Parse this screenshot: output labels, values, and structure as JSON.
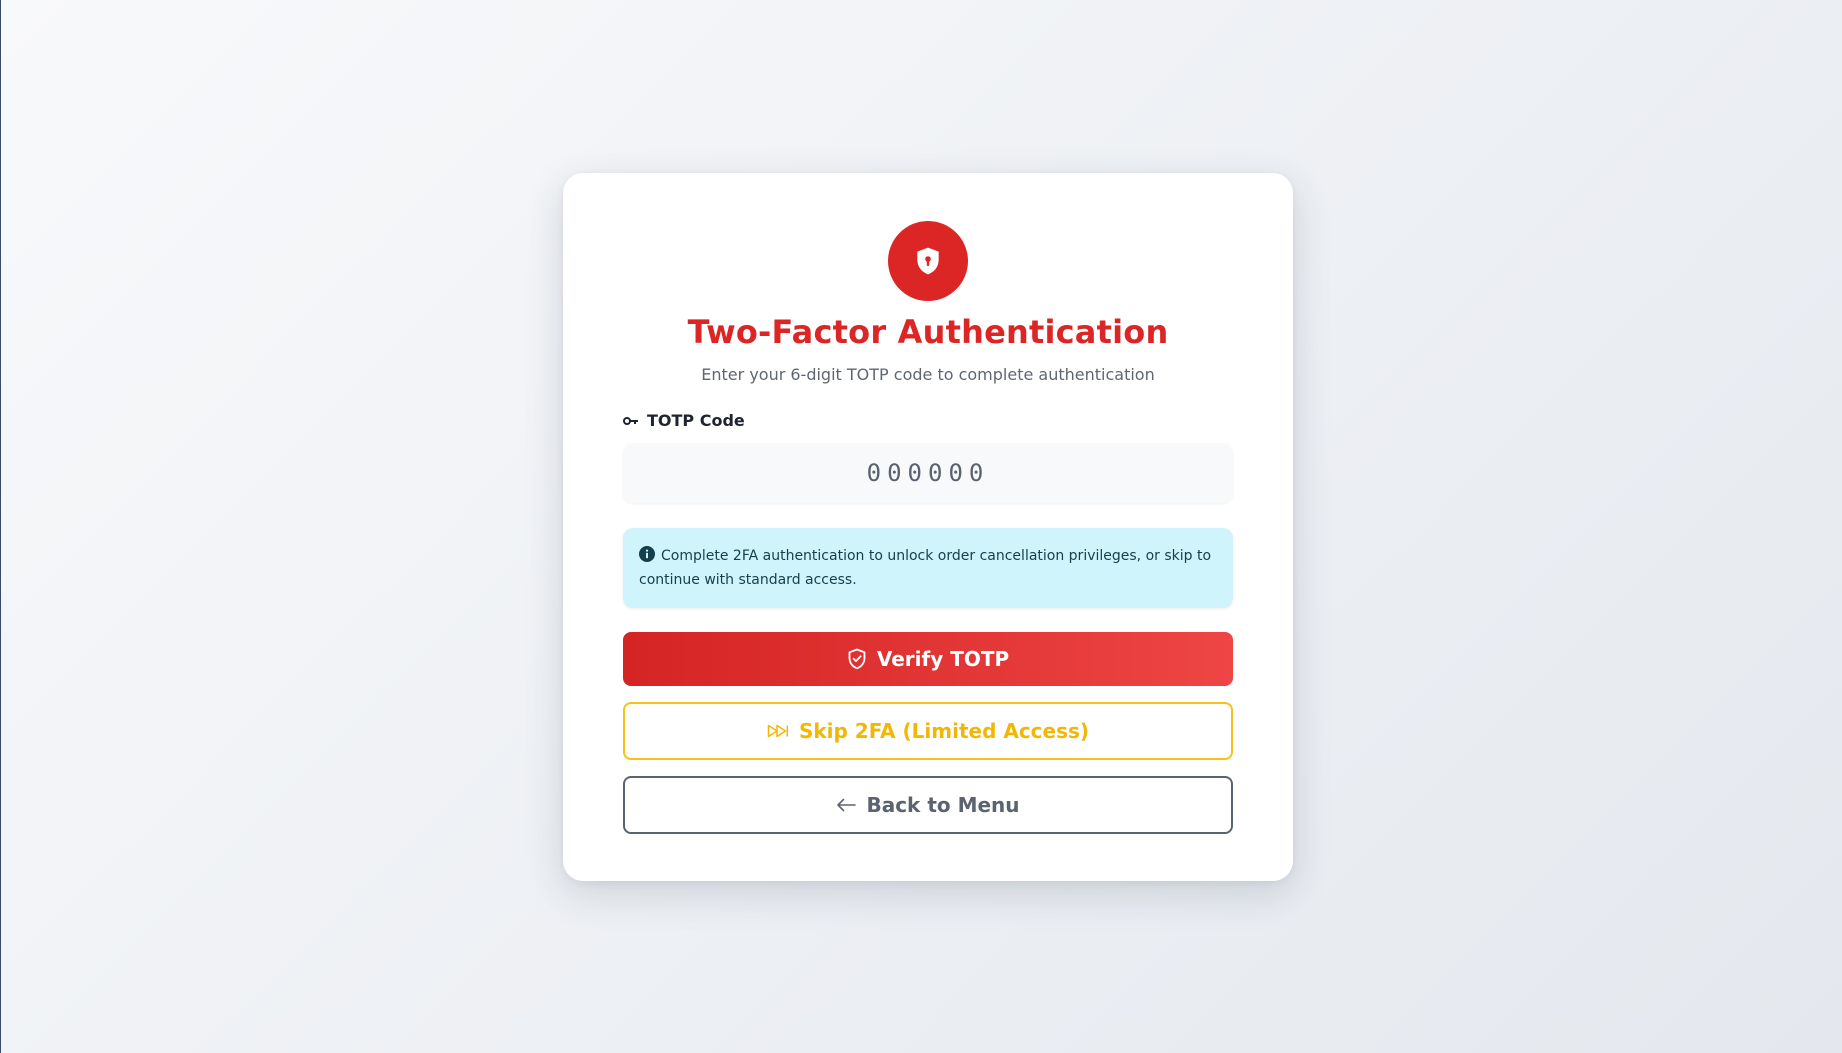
{
  "auth": {
    "title": "Two-Factor Authentication",
    "subtitle": "Enter your 6-digit TOTP code to complete authentication",
    "field_label": "TOTP Code",
    "code_placeholder": "000000",
    "code_value": "",
    "info_text": "Complete 2FA authentication to unlock order cancellation privileges, or skip to continue with standard access.",
    "verify_label": "Verify TOTP",
    "skip_label": "Skip 2FA (Limited Access)",
    "back_label": "Back to Menu"
  },
  "icons": {
    "logo": "shield-lock-icon",
    "field": "key-icon",
    "info": "info-circle-icon",
    "verify": "shield-check-icon",
    "skip": "fast-forward-icon",
    "back": "arrow-left-icon"
  },
  "colors": {
    "primary": "#dc2626",
    "warning": "#f2b705",
    "secondary": "#5c6370",
    "info_bg": "#cff4fc",
    "info_text": "#143f4c"
  }
}
